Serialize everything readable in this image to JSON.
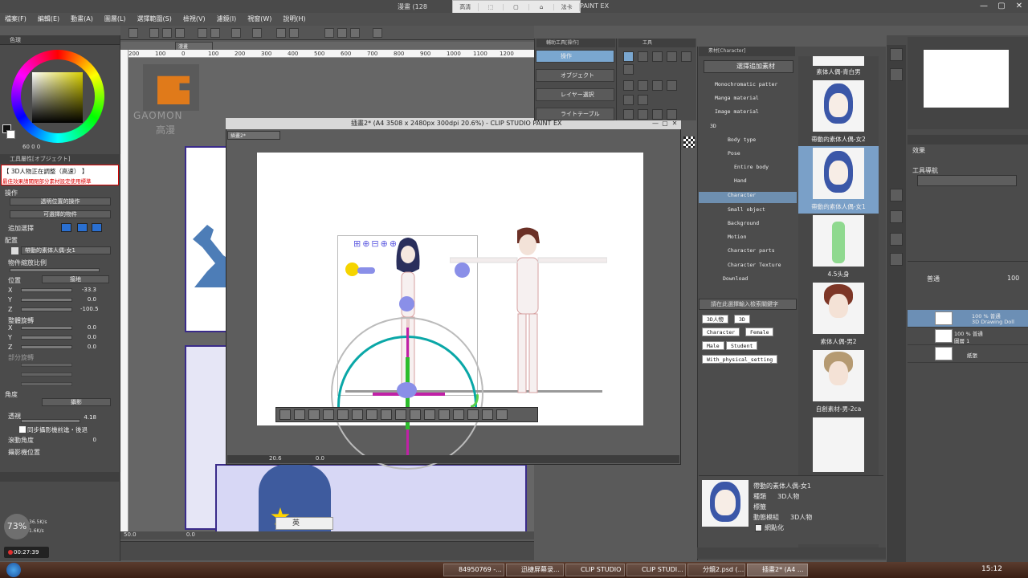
{
  "window": {
    "title_left": "漫畫 (128",
    "title_right": "PAINT EX",
    "controls": [
      "—",
      "▢",
      "✕"
    ]
  },
  "recorder_bar": [
    "高清",
    "⬚",
    "▢",
    "⌂",
    "法卡"
  ],
  "menu": [
    "檔案(F)",
    "編輯(E)",
    "動畫(A)",
    "圖層(L)",
    "選擇範圍(S)",
    "檢視(V)",
    "濾鏡(I)",
    "視窗(W)",
    "說明(H)"
  ],
  "color_panel": {
    "tab": "色環",
    "readout": "60  0  0"
  },
  "tool_property": {
    "tab": "工具屬性[オブジェクト]",
    "warning_line1": "【 3D人物正在調整（高速） 】",
    "warning_line2": "最佳效果請關閉部分素材設定使用標準",
    "section_operation": "操作",
    "transparent_op": "透明位置的操作",
    "selectable_obj": "可選擇的物件",
    "add_select": "追加選擇",
    "section_placement": "配置",
    "model_select": "帶動的素体人偶-女1",
    "object_scale": "物件縮放比例",
    "pos_label": "位置",
    "ground_btn": "接地",
    "pos_x": "-33.3",
    "pos_y": "0.0",
    "pos_z": "-100.5",
    "rot_label": "整體旋轉",
    "rot_x": "0.0",
    "rot_y": "0.0",
    "rot_z": "0.0",
    "part_rot": "部分旋轉",
    "section_angle": "角度",
    "angle_btn": "攝影",
    "perspective": "透視",
    "persp_val": "4.18",
    "sync_chk": "同步攝影機前進・後退",
    "dolly_angle": "滾動角度",
    "dolly_val": "0",
    "camera_pos": "攝影機位置"
  },
  "canvas": {
    "doc_tab": "漫畫",
    "ruler_labels": [
      "200",
      "100",
      "0",
      "100",
      "200",
      "300",
      "400",
      "500",
      "600",
      "700",
      "800",
      "900",
      "1000",
      "1100",
      "1200"
    ],
    "status_zoom": "50.0",
    "status_rot": "0.0",
    "logo_brand": "GAOMON",
    "logo_cn": "高漫",
    "ime_text": "英"
  },
  "sub_window": {
    "title": "插畫2* (A4 3508 x 2480px 300dpi 20.6%) - CLIP STUDIO PAINT EX",
    "tab": "插畫2*",
    "zoom": "20.6",
    "rot": "0.0",
    "gizmo_glyphs": "⊞⊕⊟⊕⊕♣"
  },
  "tool_panels": {
    "nav_tab": "輔助工具[操作]",
    "tool_tab": "工具",
    "subtools": [
      "操作",
      "オブジェクト",
      "レイヤー選択",
      "ライトテーブル"
    ]
  },
  "material_panel": {
    "tab": "素材[Character]",
    "add_btn": "選擇追加素材",
    "tree": [
      {
        "label": "Monochromatic patter",
        "indent": 1
      },
      {
        "label": "Manga material",
        "indent": 1
      },
      {
        "label": "Image material",
        "indent": 1
      },
      {
        "label": "3D",
        "indent": 0
      },
      {
        "label": "Body type",
        "indent": 2
      },
      {
        "label": "Pose",
        "indent": 1
      },
      {
        "label": "Entire body",
        "indent": 2
      },
      {
        "label": "Hand",
        "indent": 2
      },
      {
        "label": "Character",
        "indent": 1
      },
      {
        "label": "Small object",
        "indent": 1
      },
      {
        "label": "Background",
        "indent": 1
      },
      {
        "label": "Motion",
        "indent": 1
      },
      {
        "label": "Character parts",
        "indent": 1
      },
      {
        "label": "Character Texture",
        "indent": 1
      },
      {
        "label": "Download",
        "indent": 0
      }
    ],
    "search_placeholder": "請在此選擇輸入檢索關鍵字",
    "tags": [
      "3D人物",
      "3D",
      "Character",
      "Female",
      "Male",
      "Student",
      "With_physical_setting"
    ],
    "thumbnails": [
      "素体人偶-青白男",
      "帶動的素体人偶-女2",
      "帶動的素体人偶-女1",
      "4.5头身",
      "素体人偶-男2",
      "自創素材-男-2ca"
    ],
    "detail_name": "帶動的素体人偶-女1",
    "detail_type_label": "種類",
    "detail_type": "3D人物",
    "detail_tag_label": "標籤",
    "detail_model_label": "動態模組",
    "detail_model": "3D人物",
    "detail_check": "網點化"
  },
  "layer_panel": {
    "blend": "普通",
    "opacity": "100",
    "layers": [
      {
        "pct": "100 % 普通",
        "name": "3D Drawing Doll"
      },
      {
        "pct": "100 % 普通",
        "name": "圖層 1"
      },
      {
        "pct": "",
        "name": "紙張"
      }
    ]
  },
  "effect_panel": {
    "label": "效果",
    "tool_nav": "工具導航"
  },
  "taskbar": {
    "apps": [
      "84950769 -...",
      "迅捷屏幕录...",
      "CLIP STUDIO",
      "CLIP STUDI...",
      "分鏡2.psd (...",
      "插畫2* (A4 ..."
    ],
    "clock": "15:12"
  },
  "overlay": {
    "percent": "73%",
    "net_up": "36.5K/s",
    "net_down": "1.6K/s",
    "timer": "00:27:39"
  }
}
